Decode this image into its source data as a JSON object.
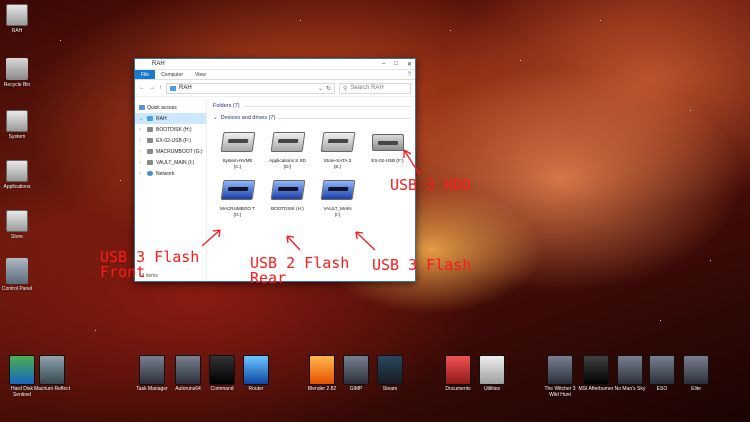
{
  "desktop_icons": [
    {
      "label": "RAH"
    },
    {
      "label": "Recycle Bin"
    },
    {
      "label": "System"
    },
    {
      "label": "Applications"
    },
    {
      "label": "Store"
    },
    {
      "label": "Control Panel"
    }
  ],
  "window": {
    "title": "RAH",
    "tabs": [
      "File",
      "Computer",
      "View"
    ],
    "address": "RAH",
    "search_placeholder": "Search RAH",
    "nav_items": [
      {
        "label": "Quick access"
      },
      {
        "label": "RAH"
      },
      {
        "label": "BOOTDISK (H:)"
      },
      {
        "label": "EX-02-USB (F:)"
      },
      {
        "label": "MACRUMBOOT (G:)"
      },
      {
        "label": "VAULT_MAIN (I:)"
      },
      {
        "label": "Network"
      }
    ],
    "folders_header": "Folders (7)",
    "devices_header": "Devices and drives (7)",
    "drives": [
      {
        "name": "System-NVME",
        "letter": "(C:)"
      },
      {
        "name": "Applications S SD",
        "letter": "(D:)"
      },
      {
        "name": "Store-SATA 3",
        "letter": "(E:)"
      },
      {
        "name": "EX-02-USB (F:)",
        "letter": ""
      },
      {
        "name": "MACRUMBOO T",
        "letter": "(G:)"
      },
      {
        "name": "BOOTDISK (H:)",
        "letter": ""
      },
      {
        "name": "VAULT_MAIN",
        "letter": "(I:)"
      }
    ],
    "status": "14 items"
  },
  "bottom_icons": [
    {
      "label": "Hard Disk Sentinel"
    },
    {
      "label": "Macrium Reflect"
    },
    {
      "label": "Task Manager"
    },
    {
      "label": "Autoruns64"
    },
    {
      "label": "Command"
    },
    {
      "label": "Router"
    },
    {
      "label": "Blender 2.82"
    },
    {
      "label": "GIMP"
    },
    {
      "label": "Steam"
    },
    {
      "label": "Documents"
    },
    {
      "label": "Utilities"
    },
    {
      "label": "The Witcher 3 Wild Hunt"
    },
    {
      "label": "MSI Afterburner"
    },
    {
      "label": "No Man's Sky"
    },
    {
      "label": "ESO"
    },
    {
      "label": "Elite"
    }
  ],
  "annotations": {
    "hdd": "USB 3 HDD",
    "flash_front": "USB 3 Flash\nFront",
    "flash_rear": "USB 2 Flash\nRear",
    "flash": "USB 3 Flash"
  }
}
